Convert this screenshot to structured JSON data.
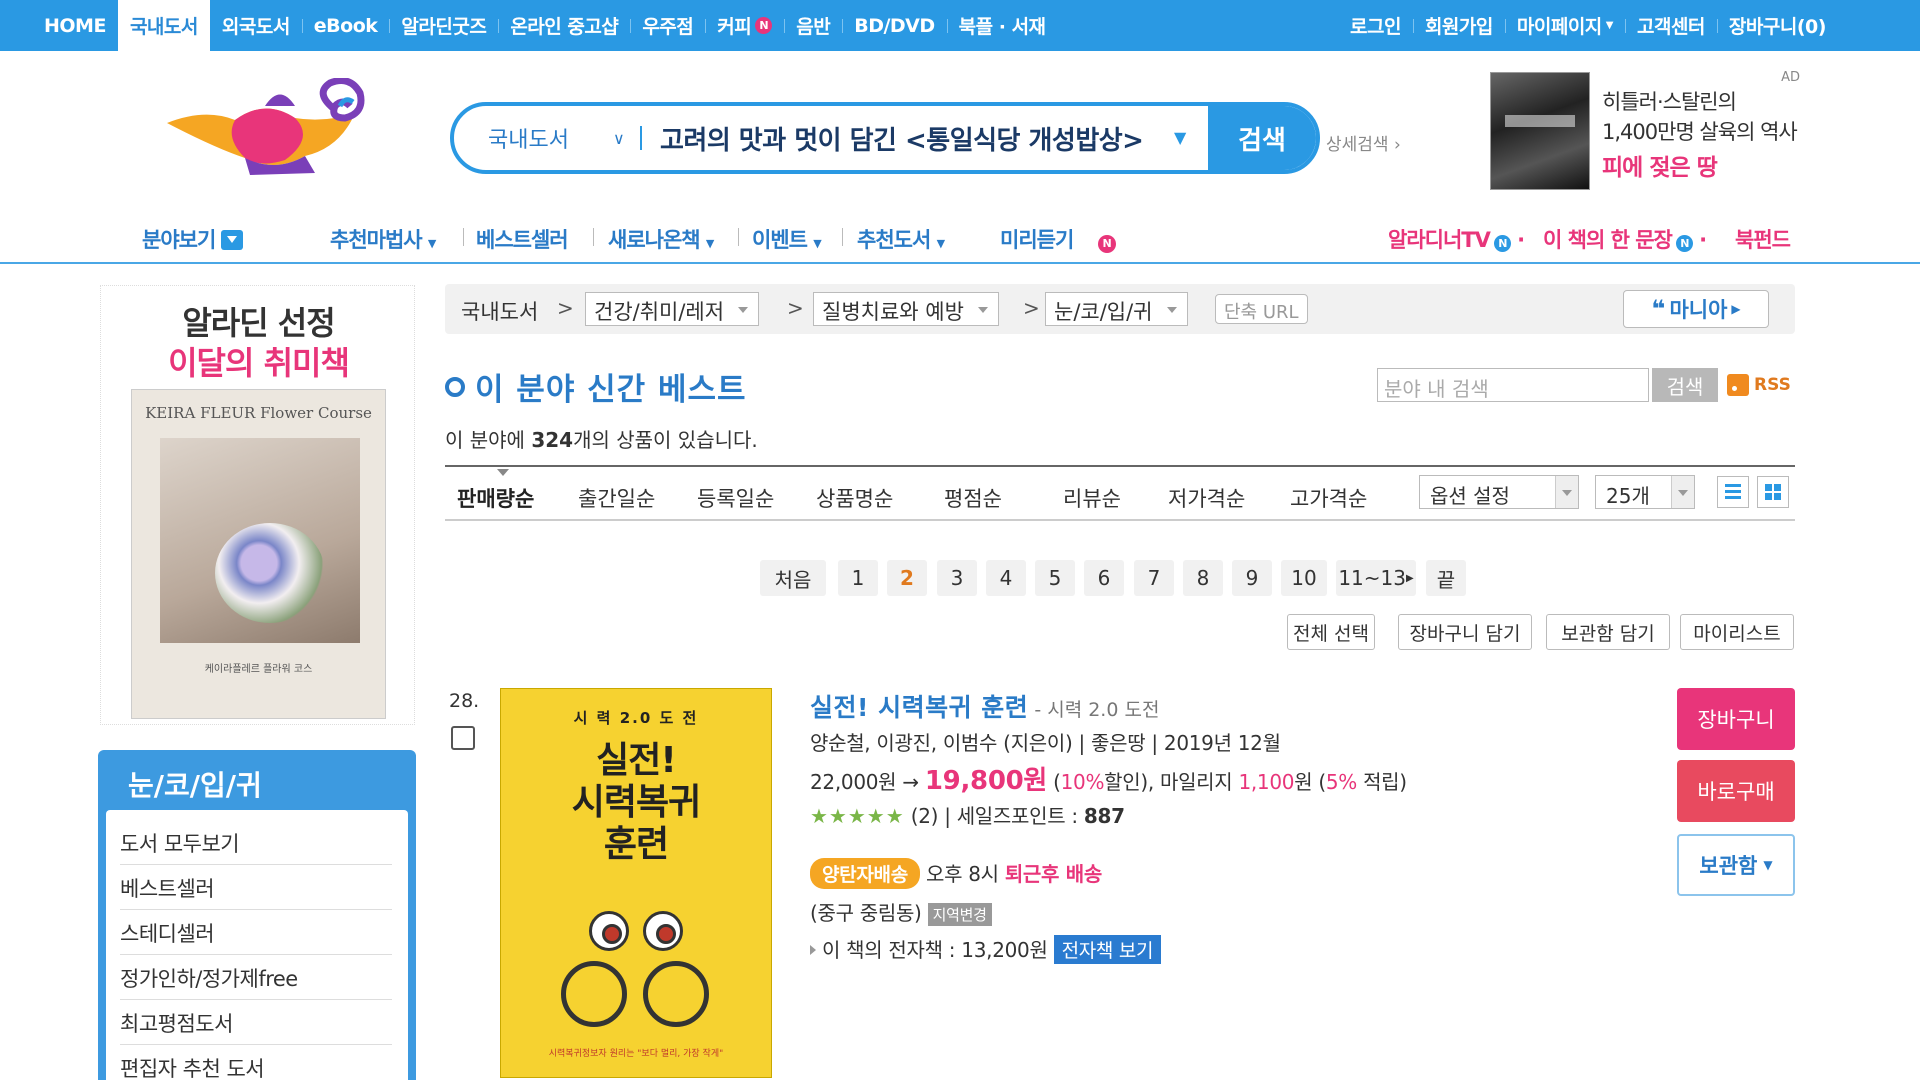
{
  "topnav": {
    "left": [
      "HOME",
      "국내도서",
      "외국도서",
      "eBook",
      "알라딘굿즈",
      "온라인 중고샵",
      "우주점",
      "커피",
      "음반",
      "BD/DVD",
      "북플 · 서재"
    ],
    "coffee_badge": "N",
    "right": [
      "로그인",
      "회원가입",
      "마이페이지",
      "고객센터",
      "장바구니(0)"
    ]
  },
  "search": {
    "category": "국내도서",
    "query": "고려의 맛과 멋이 담긴 <통일식당 개성밥상>",
    "button": "검색",
    "detail": "상세검색"
  },
  "ad": {
    "tag": "AD",
    "line1": "히틀러·스탈린의",
    "line2": "1,400만명 살육의 역사",
    "line3": "피에 젖은 땅"
  },
  "subnav": {
    "category": "분야보기",
    "items": [
      "추천마법사",
      "베스트셀러",
      "새로나온책",
      "이벤트",
      "추천도서",
      "미리듣기"
    ],
    "listen_badge": "N",
    "right": [
      "알라디너TV",
      "이 책의 한 문장",
      "북펀드"
    ],
    "right_badge": "N"
  },
  "promo": {
    "title1": "알라딘 선정",
    "title2": "이달의 취미책",
    "book_title": "KEIRA FLEUR Flower Course",
    "book_caption": "케이라플레르 플라워 코스"
  },
  "category_box": {
    "title": "눈/코/입/귀",
    "items": [
      "도서 모두보기",
      "베스트셀러",
      "스테디셀러",
      "정가인하/정가제free",
      "최고평점도서",
      "편집자 추천 도서"
    ]
  },
  "breadcrumb": {
    "root": "국내도서",
    "level1": "건강/취미/레저",
    "level2": "질병치료와 예방",
    "level3": "눈/코/입/귀",
    "short_url": "단축 URL",
    "mania": "마니아"
  },
  "section": {
    "title": "이 분야 신간 베스트",
    "filter_placeholder": "분야 내 검색",
    "filter_button": "검색",
    "rss": "RSS",
    "count_prefix": "이 분야에 ",
    "count": "324",
    "count_suffix": "개의 상품이 있습니다."
  },
  "sort": {
    "options": [
      "판매량순",
      "출간일순",
      "등록일순",
      "상품명순",
      "평점순",
      "리뷰순",
      "저가격순",
      "고가격순"
    ],
    "option_select": "옵션 설정",
    "page_size": "25개"
  },
  "pager": {
    "first": "처음",
    "pages": [
      "1",
      "2",
      "3",
      "4",
      "5",
      "6",
      "7",
      "8",
      "9",
      "10"
    ],
    "current": "2",
    "next": "11~13",
    "last": "끝"
  },
  "actions": [
    "전체 선택",
    "장바구니 담기",
    "보관함 담기",
    "마이리스트"
  ],
  "product": {
    "rank": "28.",
    "title": "실전! 시력복귀 훈련",
    "subtitle": "- 시력 2.0 도전",
    "authors": "양순철, 이광진, 이범수 (지은이) | 좋은땅 | 2019년 12월",
    "list_price": "22,000원",
    "arrow": "→",
    "sale_price": "19,800원",
    "discount_open": " (",
    "discount_pct": "10%",
    "discount_rest": "할인), 마일리지 ",
    "mileage": "1,100",
    "mileage_unit": "원 (",
    "mileage_pct": "5%",
    "mileage_end": " 적립)",
    "stars": "★★★★★",
    "review_text": "(2) | 세일즈포인트 : ",
    "sales_point": "887",
    "ship_badge": "양탄자배송",
    "ship_time": " 오후 8시 ",
    "ship_label": "퇴근후 배송",
    "region": "(중구 중림동)",
    "region_btn": "지역변경",
    "ebook_prefix": "이 책의 전자책 : ",
    "ebook_price": "13,200원",
    "ebook_btn": "전자책 보기",
    "cover_top": "시 력 2.0 도 전",
    "cover_line1": "실전!",
    "cover_line2": "시력복귀",
    "cover_line3": "훈련",
    "cover_tagline": "시력복귀정보자 원리는 \"보다 멀리, 가장 작게\""
  },
  "side_buttons": {
    "cart": "장바구니",
    "buy": "바로구매",
    "keep": "보관함"
  }
}
